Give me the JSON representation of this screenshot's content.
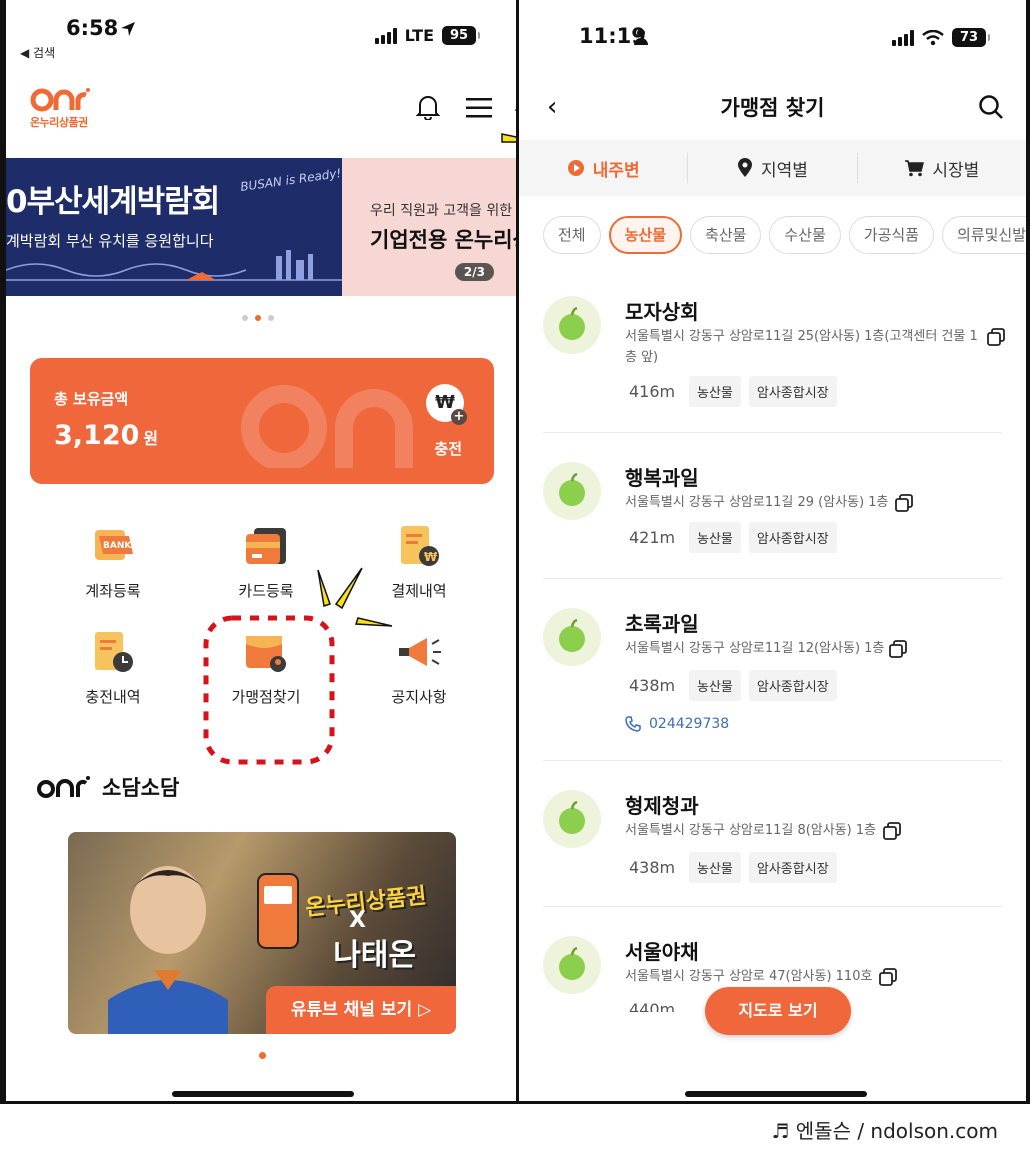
{
  "left": {
    "status": {
      "time": "6:58",
      "back": "◀ 검색",
      "network": "LTE",
      "battery": "95"
    },
    "logo_text": "온누리상품권",
    "banner": {
      "slide1_line1": "0부산세계박람회",
      "slide1_line2": "계박람회 부산 유치를 응원합니다",
      "slide1_badge": "BUSAN is Ready!",
      "slide2_line1": "우리 직원과 고객을 위한",
      "slide2_line2": "기업전용 온누리상",
      "pager": "2/3"
    },
    "balance": {
      "label": "총 보유금액",
      "amount": "3,120",
      "unit": "원",
      "charge_symbol": "₩",
      "charge_label": "충전"
    },
    "menu": [
      {
        "label": "계좌등록",
        "icon": "bank-icon",
        "icon_text": "BANK"
      },
      {
        "label": "카드등록",
        "icon": "card-icon"
      },
      {
        "label": "결제내역",
        "icon": "receipt-icon",
        "icon_text": "₩"
      },
      {
        "label": "충전내역",
        "icon": "charge-history-icon"
      },
      {
        "label": "가맹점찾기",
        "icon": "store-location-icon"
      },
      {
        "label": "공지사항",
        "icon": "megaphone-icon"
      }
    ],
    "sodam": {
      "title": "소담소담"
    },
    "promo": {
      "brand": "온누리상품권",
      "x": "X",
      "name": "나태온",
      "button": "유튜브 채널 보기"
    }
  },
  "right": {
    "status": {
      "time": "11:19",
      "battery": "73"
    },
    "title": "가맹점 찾기",
    "segments": [
      {
        "label": "내주변",
        "icon": "play-circle-icon",
        "active": true
      },
      {
        "label": "지역별",
        "icon": "pin-icon",
        "active": false
      },
      {
        "label": "시장별",
        "icon": "cart-icon",
        "active": false
      }
    ],
    "chips": [
      "전체",
      "농산물",
      "축산물",
      "수산물",
      "가공식품",
      "의류및신발"
    ],
    "active_chip": 1,
    "stores": [
      {
        "name": "모자상회",
        "address": "서울특별시 강동구 상암로11길 25(암사동) 1층(고객센터 건물 1층 앞)",
        "distance": "416m",
        "category": "농산물",
        "market": "암사종합시장",
        "phone": ""
      },
      {
        "name": "행복과일",
        "address": "서울특별시 강동구 상암로11길 29 (암사동) 1층",
        "distance": "421m",
        "category": "농산물",
        "market": "암사종합시장",
        "phone": ""
      },
      {
        "name": "초록과일",
        "address": "서울특별시 강동구 상암로11길 12(암사동) 1층",
        "distance": "438m",
        "category": "농산물",
        "market": "암사종합시장",
        "phone": "024429738"
      },
      {
        "name": "형제청과",
        "address": "서울특별시 강동구 상암로11길 8(암사동) 1층",
        "distance": "438m",
        "category": "농산물",
        "market": "암사종합시장",
        "phone": ""
      },
      {
        "name": "서울야채",
        "address": "서울특별시 강동구 상암로 47(암사동) 110호",
        "distance": "440m",
        "category": "",
        "market": "",
        "phone": ""
      }
    ],
    "map_button": "지도로 보기"
  },
  "watermark": "♬ 엔돌슨 / ndolson.com",
  "colors": {
    "accent": "#f06b33",
    "navy": "#1e2d6a",
    "apple": "#8ccf4d"
  }
}
